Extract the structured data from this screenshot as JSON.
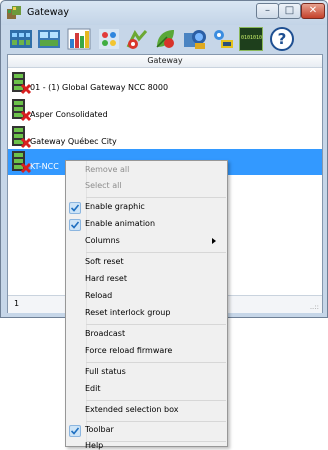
{
  "window": {
    "title": "Gateway",
    "controls": {
      "minimize": "–",
      "maximize": "□",
      "close": "✕"
    }
  },
  "toolbar": {
    "buttons": [
      {
        "icon": "network-overview-icon"
      },
      {
        "icon": "gateway-monitor-icon"
      },
      {
        "icon": "bar-graph-icon"
      },
      {
        "icon": "palette-icon"
      },
      {
        "icon": "reset-tool-icon"
      },
      {
        "icon": "leaf-config-icon"
      },
      {
        "icon": "network-shield-icon"
      },
      {
        "icon": "connection-icon"
      },
      {
        "icon": "binary-display-icon"
      },
      {
        "icon": "help-icon"
      }
    ],
    "help_symbol": "?",
    "binary_text": "0101010"
  },
  "list": {
    "column_header": "Gateway",
    "rows": [
      {
        "label": "01 - (1)  Global Gateway NCC 8000",
        "selected": false
      },
      {
        "label": "Asper Consolidated",
        "selected": false
      },
      {
        "label": "Gateway Québec City",
        "selected": false
      },
      {
        "label": "KT-NCC",
        "selected": true
      }
    ]
  },
  "statusbar": {
    "count": "1",
    "grip": "..::"
  },
  "context_menu": {
    "items": [
      {
        "label": "Remove all",
        "disabled": true
      },
      {
        "label": "Select all",
        "disabled": true
      },
      {
        "label": "Enable graphic",
        "checked": true
      },
      {
        "label": "Enable animation",
        "checked": true
      },
      {
        "label": "Columns",
        "submenu": true
      },
      {
        "label": "Soft reset"
      },
      {
        "label": "Hard reset"
      },
      {
        "label": "Reload"
      },
      {
        "label": "Reset interlock group"
      },
      {
        "label": "Broadcast"
      },
      {
        "label": "Force reload firmware"
      },
      {
        "label": "Full status"
      },
      {
        "label": "Edit"
      },
      {
        "label": "Extended selection box"
      },
      {
        "label": "Toolbar",
        "checked": true
      },
      {
        "label": "Help"
      }
    ]
  },
  "colors": {
    "selection": "#3399ff",
    "accent_check": "#1f6fc0"
  }
}
